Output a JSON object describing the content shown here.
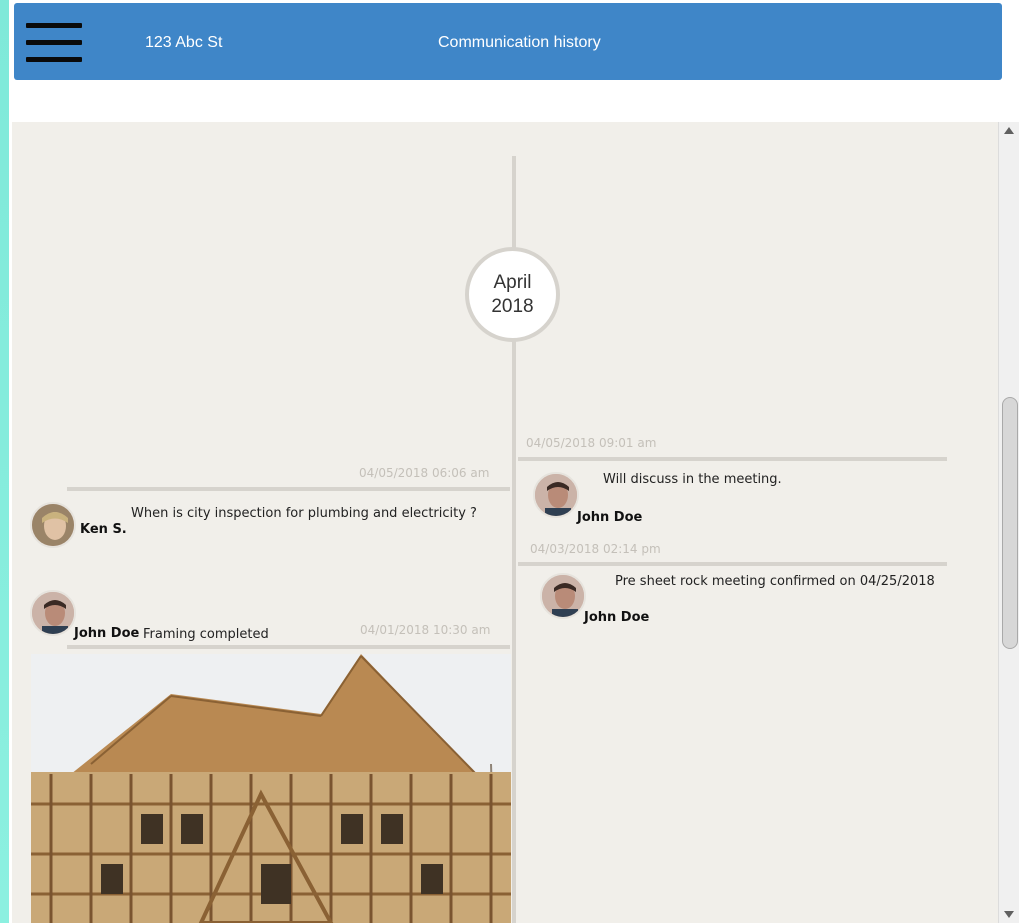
{
  "header": {
    "address": "123 Abc St",
    "title": "Communication history",
    "accent_color": "#3f86c8",
    "menu_icon": "hamburger-menu-icon"
  },
  "timeline": {
    "month": "April",
    "year": "2018",
    "entries": [
      {
        "timestamp": "04/05/2018 09:01 am",
        "message": "Will discuss in the meeting.",
        "author": "John Doe"
      },
      {
        "timestamp": "04/05/2018 06:06 am",
        "message": "When is city inspection for plumbing and electricity ?",
        "author": "Ken S."
      },
      {
        "timestamp": "04/03/2018 02:14 pm",
        "message": "Pre sheet rock meeting confirmed on 04/25/2018",
        "author": "John Doe"
      },
      {
        "timestamp": "04/01/2018 10:30 am",
        "message": "Framing completed",
        "author": "John Doe",
        "attachment": "house-framing-photo"
      }
    ]
  },
  "scrollbar": {
    "up_icon": "scroll-up-arrow-icon",
    "down_icon": "scroll-down-arrow-icon"
  }
}
